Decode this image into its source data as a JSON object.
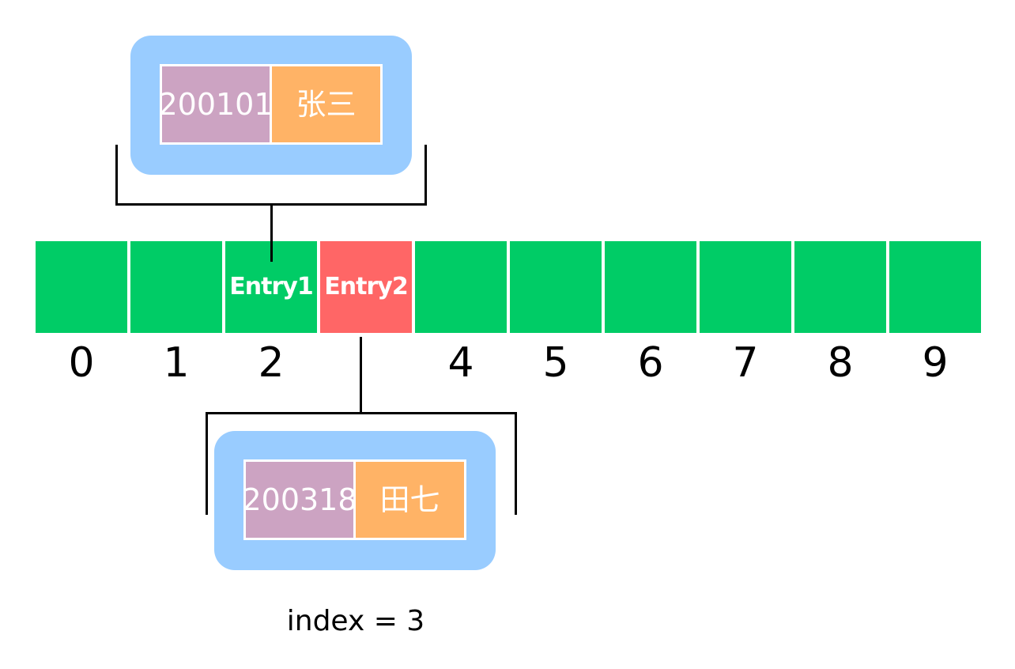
{
  "slots": [
    {
      "index": "0",
      "label": ""
    },
    {
      "index": "1",
      "label": ""
    },
    {
      "index": "2",
      "label": "Entry1"
    },
    {
      "index": "",
      "label": "Entry2"
    },
    {
      "index": "4",
      "label": ""
    },
    {
      "index": "5",
      "label": ""
    },
    {
      "index": "6",
      "label": ""
    },
    {
      "index": "7",
      "label": ""
    },
    {
      "index": "8",
      "label": ""
    },
    {
      "index": "9",
      "label": ""
    }
  ],
  "entry1": {
    "key": "200101",
    "value": "张三"
  },
  "entry2": {
    "key": "200318",
    "value": "田七"
  },
  "caption": "index = 3",
  "colors": {
    "slot": "#00cc66",
    "collision_slot": "#ff6666",
    "card": "#99ccff",
    "key_cell": "#cca3c2",
    "value_cell": "#ffb366"
  }
}
